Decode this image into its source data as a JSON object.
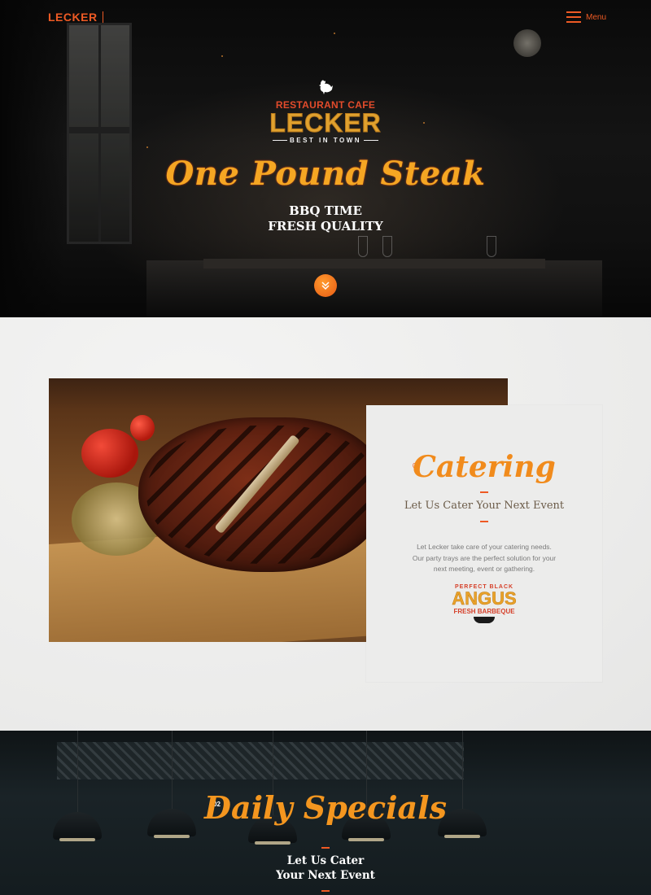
{
  "header": {
    "brand": "LECKER",
    "menu_label": "Menu"
  },
  "hero": {
    "logo_tagline": "RESTAURANT CAFE",
    "logo_name": "LECKER",
    "logo_subline": "BEST IN TOWN",
    "script_title": "One Pound Steak",
    "line1": "BBQ TIME",
    "line2": "FRESH QUALITY"
  },
  "catering": {
    "number": "01",
    "script_title": "Catering",
    "subtitle": "Let Us Cater Your Next Event",
    "body": "Let Lecker take care of your catering needs. Our party trays are the perfect solution for your next meeting, event or gathering.",
    "badge_top": "PERFECT BLACK",
    "badge_name": "ANGUS",
    "badge_sub": "FRESH BARBEQUE"
  },
  "specials": {
    "number": "02",
    "script_title": "Daily Specials",
    "line1": "Let Us Cater",
    "line2": "Your Next Event"
  },
  "colors": {
    "accent": "#ee5a24",
    "script_orange": "#f5a623",
    "logo_gold": "#e0a12e"
  },
  "icons": {
    "menu": "hamburger-icon",
    "scroll": "chevron-down-double-icon",
    "logo": "chicken-icon"
  }
}
